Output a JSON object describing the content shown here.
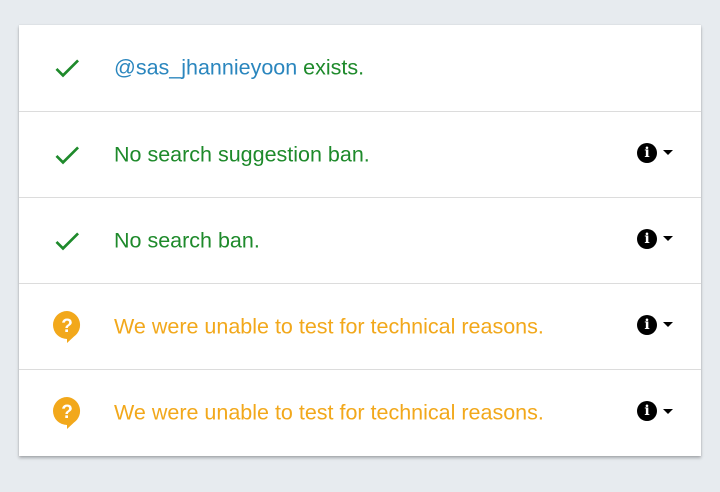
{
  "colors": {
    "success": "#1e8a2b",
    "warning": "#f2a81b",
    "handle": "#2a86be",
    "background": "#e7ebef"
  },
  "results": [
    {
      "status": "success",
      "icon": "check-icon",
      "handle": "@sas_jhannieyoon",
      "text": " exists.",
      "has_info": false
    },
    {
      "status": "success",
      "icon": "check-icon",
      "text": "No search suggestion ban.",
      "has_info": true,
      "info_icon": "info-icon",
      "info_glyph": "i",
      "dropdown_icon": "caret-down-icon"
    },
    {
      "status": "success",
      "icon": "check-icon",
      "text": "No search ban.",
      "has_info": true,
      "info_icon": "info-icon",
      "info_glyph": "i",
      "dropdown_icon": "caret-down-icon"
    },
    {
      "status": "warning",
      "icon": "question-bubble-icon",
      "text": "We were unable to test for technical reasons.",
      "has_info": true,
      "info_icon": "info-icon",
      "info_glyph": "i",
      "dropdown_icon": "caret-down-icon"
    },
    {
      "status": "warning",
      "icon": "question-bubble-icon",
      "text": "We were unable to test for technical reasons.",
      "has_info": true,
      "info_icon": "info-icon",
      "info_glyph": "i",
      "dropdown_icon": "caret-down-icon"
    }
  ]
}
